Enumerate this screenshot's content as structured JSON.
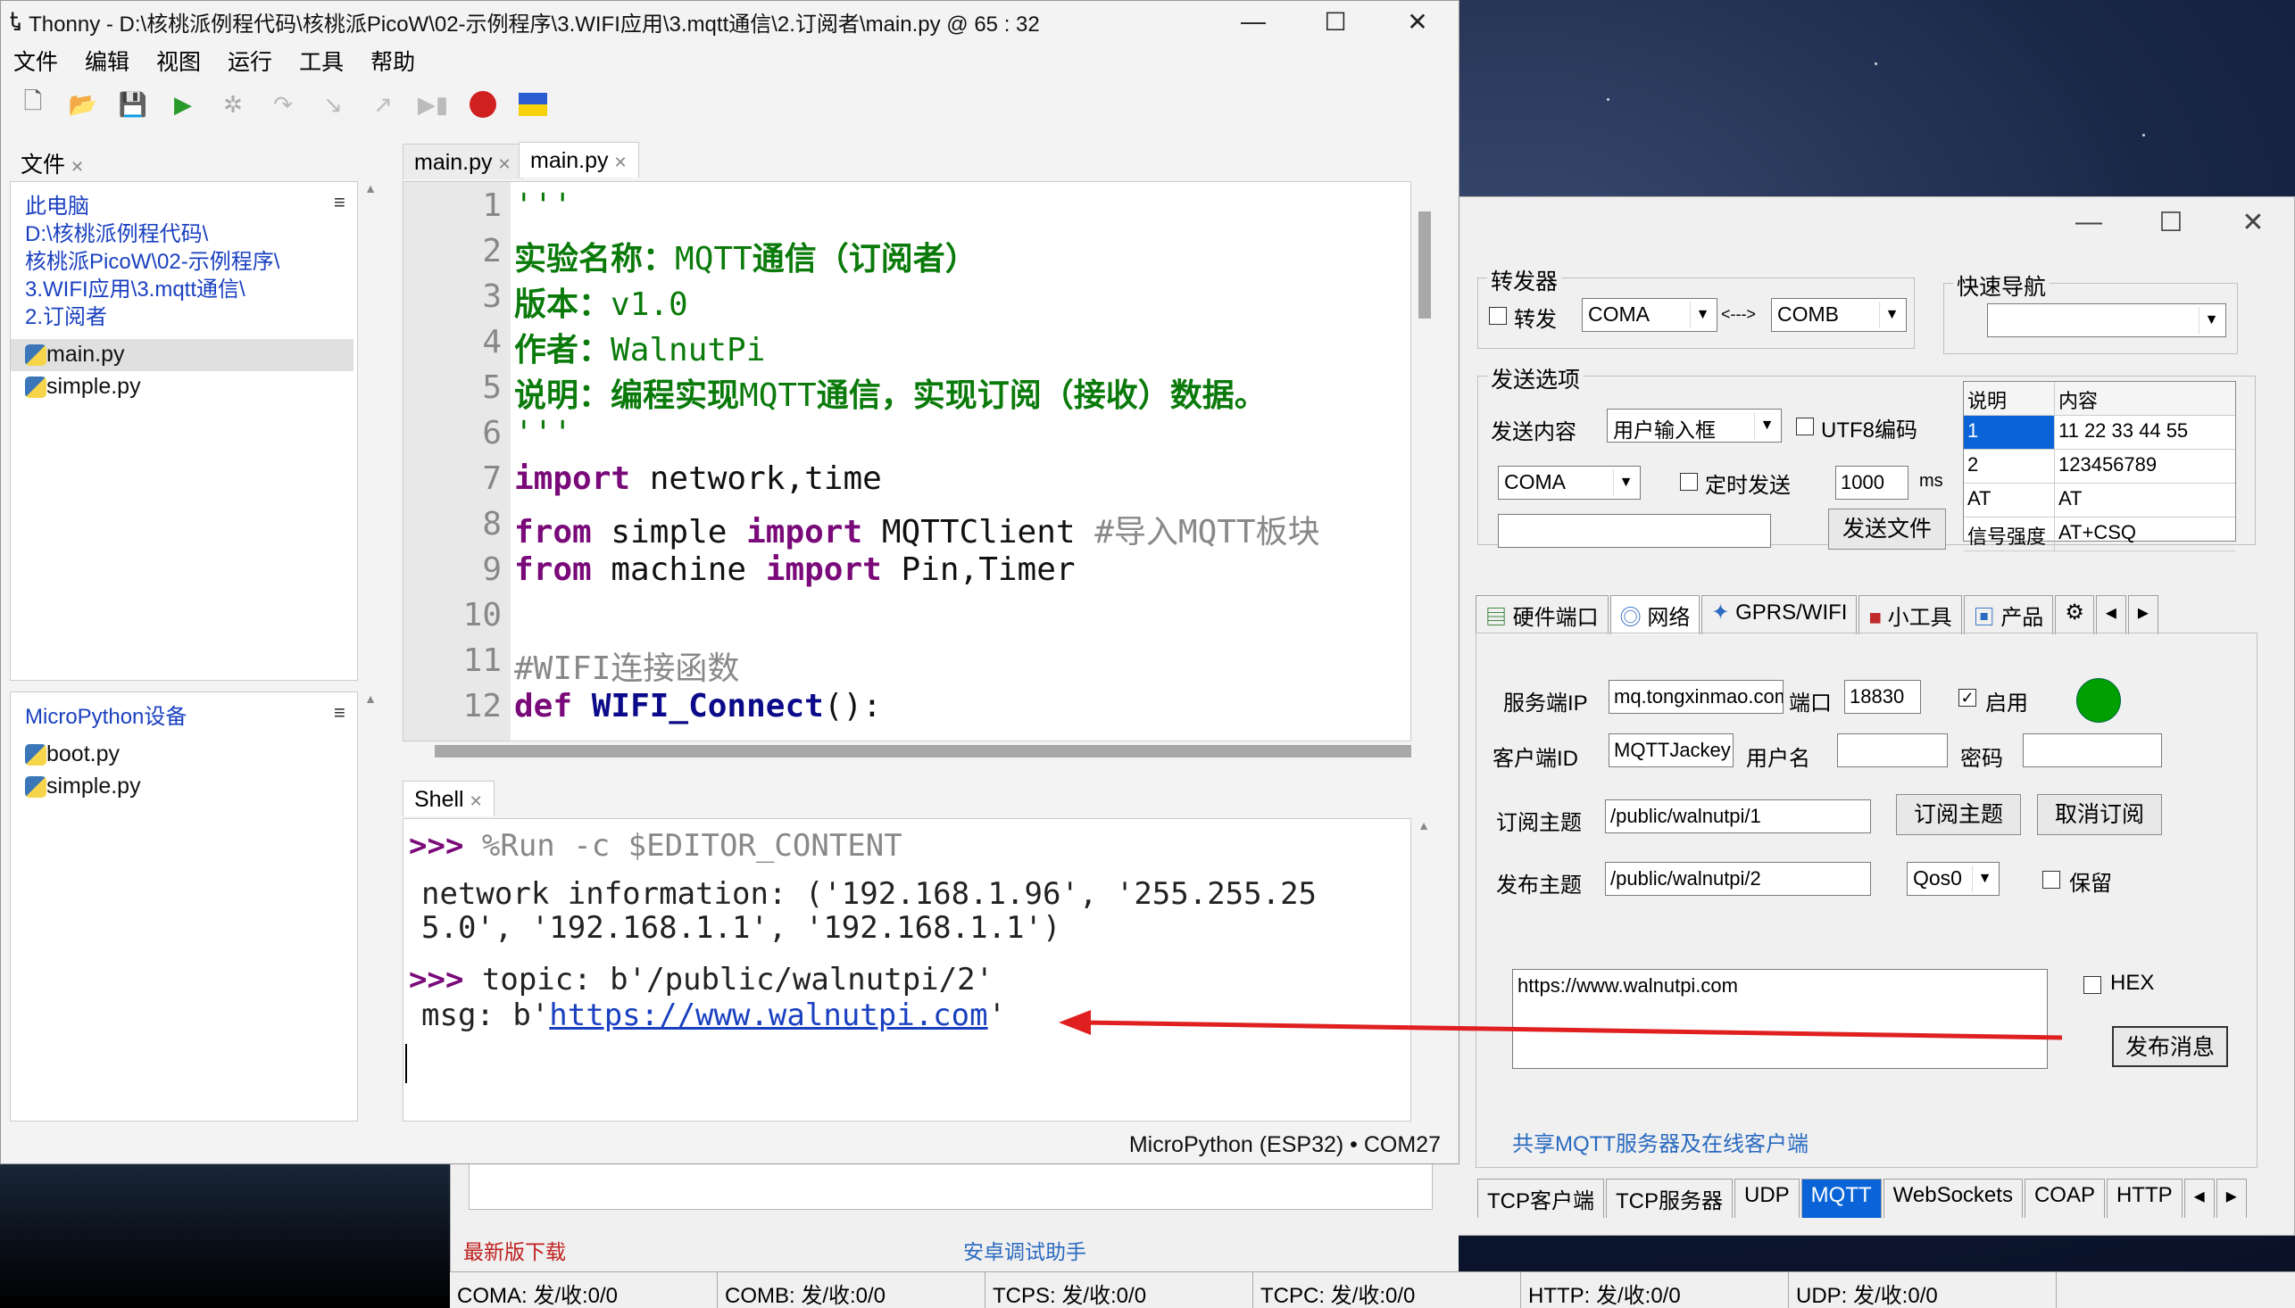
{
  "tool": {
    "fwd_group": "转发器",
    "fwd_label": "转发",
    "port_a": "COMA",
    "arrow": "<--->",
    "port_b": "COMB",
    "nav_group": "快速导航",
    "send_group": "发送选项",
    "send_content_label": "发送内容",
    "send_content_value": "用户输入框",
    "utf8_label": "UTF8编码",
    "send_port": "COMA",
    "timer_label": "定时发送",
    "interval": "1000",
    "ms": "ms",
    "send_file_btn": "发送文件",
    "grid_header": [
      "说明",
      "内容"
    ],
    "grid_rows": [
      [
        "1",
        "11 22 33 44 55"
      ],
      [
        "2",
        "123456789"
      ],
      [
        "AT",
        "AT"
      ],
      [
        "信号强度",
        "AT+CSQ"
      ]
    ],
    "top_tabs": [
      "硬件端口",
      "网络",
      "GPRS/WIFI",
      "小工具",
      "产品"
    ],
    "server_ip_label": "服务端IP",
    "server_ip": "mq.tongxinmao.com",
    "port_label": "端口",
    "port_value": "18830",
    "enable_label": "启用",
    "client_id_label": "客户端ID",
    "client_id": "MQTTJackey",
    "username_label": "用户名",
    "password_label": "密码",
    "sub_topic_label": "订阅主题",
    "sub_topic": "/public/walnutpi/1",
    "sub_btn": "订阅主题",
    "unsub_btn": "取消订阅",
    "pub_topic_label": "发布主题",
    "pub_topic": "/public/walnutpi/2",
    "qos": "Qos0",
    "retain_label": "保留",
    "message": "https://www.walnutpi.com",
    "hex_label": "HEX",
    "publish_btn": "发布消息",
    "footer_link": "共享MQTT服务器及在线客户端",
    "bottom_tabs": [
      "TCP客户端",
      "TCP服务器",
      "UDP",
      "MQTT",
      "WebSockets",
      "COAP",
      "HTTP"
    ],
    "latest_link": "最新版下载",
    "android_link": "安卓调试助手",
    "status": [
      "COMA: 发/收:0/0",
      "COMB: 发/收:0/0",
      "TCPS: 发/收:0/0",
      "TCPC: 发/收:0/0",
      "HTTP: 发/收:0/0",
      "UDP: 发/收:0/0"
    ],
    "status_color": "#00a000"
  },
  "thonny": {
    "title": "Thonny  -  D:\\核桃派例程代码\\核桃派PicoW\\02-示例程序\\3.WIFI应用\\3.mqtt通信\\2.订阅者\\main.py  @  65 : 32",
    "menu": [
      "文件",
      "编辑",
      "视图",
      "运行",
      "工具",
      "帮助"
    ],
    "files_tab": "文件",
    "computer_label": "此电脑",
    "path_lines": [
      "D:\\核桃派例程代码\\",
      "核桃派PicoW\\02-示例程序\\",
      "3.WIFI应用\\3.mqtt通信\\",
      "2.订阅者"
    ],
    "local_files": [
      "main.py",
      "simple.py"
    ],
    "device_label": "MicroPython设备",
    "device_files": [
      "boot.py",
      "simple.py"
    ],
    "editor_tabs": [
      "main.py",
      "main.py"
    ],
    "line_numbers": [
      "1",
      "2",
      "3",
      "4",
      "5",
      "6",
      "7",
      "8",
      "9",
      "10",
      "11",
      "12"
    ],
    "code": {
      "l1": "'''",
      "l2a": "实验名称：",
      "l2b": "MQTT",
      "l2c": "通信（订阅者）",
      "l3a": "版本：",
      "l3b": "v1.0",
      "l4a": "作者：",
      "l4b": "WalnutPi",
      "l5a": "说明：编程实现",
      "l5b": "MQTT",
      "l5c": "通信，实现订阅（接收）数据。",
      "l6": "'''",
      "l7a": "import",
      "l7b": " network,time",
      "l8a": "from",
      "l8b": " simple ",
      "l8c": "import",
      "l8d": " MQTTClient ",
      "l8e": "#导入MQTT板块",
      "l9a": "from",
      "l9b": " machine ",
      "l9c": "import",
      "l9d": " Pin,Timer",
      "l11": "#WIFI连接函数",
      "l12a": "def",
      "l12b": " ",
      "l12c": "WIFI_Connect",
      "l12d": "():"
    },
    "shell_tab": "Shell",
    "shell": {
      "p1": ">>>",
      "cmd1": " %Run -c $EDITOR_CONTENT",
      "out1": "network information: ('192.168.1.96', '255.255.25",
      "out2": "5.0', '192.168.1.1', '192.168.1.1')",
      "p2": ">>>",
      "out3": " topic: b'/public/walnutpi/2'",
      "out4a": "msg: b'",
      "out4b": "https://www.walnutpi.com",
      "out4c": "'"
    },
    "status": "MicroPython (ESP32)  •  COM27"
  }
}
